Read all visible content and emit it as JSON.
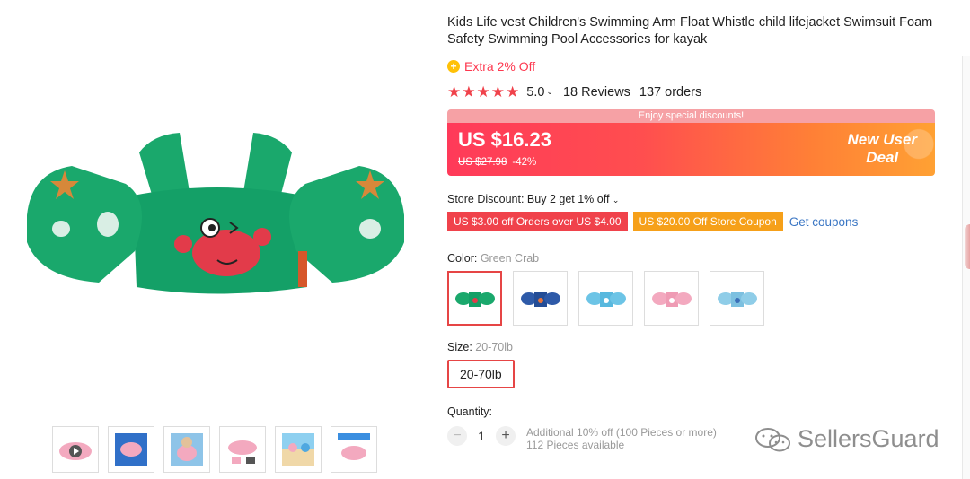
{
  "product": {
    "title": "Kids Life vest Children's Swimming Arm Float Whistle child lifejacket Swimsuit Foam Safety Swimming Pool Accessories for kayak",
    "extra_badge": "Extra 2% Off",
    "rating": {
      "stars": 5,
      "score": "5.0",
      "reviews": "18 Reviews",
      "orders": "137 orders"
    },
    "main_image": "green-crab-arm-float-vest",
    "thumbnails": [
      "pink-vest-video-thumb",
      "product-box-thumb",
      "child-wearing-vest-thumb",
      "pink-vest-detail-thumb",
      "kids-at-beach-thumb",
      "pink-vest-banner-thumb"
    ]
  },
  "deal": {
    "banner_text": "Enjoy special discounts!",
    "price": "US $16.23",
    "original_price": "US $27.98",
    "discount": "-42%",
    "badge_line1": "New User",
    "badge_line2": "Deal"
  },
  "store": {
    "discount_text": "Store Discount: Buy 2 get 1% off",
    "coupons": [
      "US $3.00 off Orders over US $4.00",
      "US $20.00 Off Store Coupon"
    ],
    "get_coupons": "Get coupons"
  },
  "color": {
    "label": "Color:",
    "selected": "Green Crab",
    "swatches": [
      "green",
      "navy",
      "light-blue",
      "pink",
      "sky-blue"
    ]
  },
  "size": {
    "label": "Size:",
    "selected": "20-70lb",
    "option": "20-70lb"
  },
  "quantity": {
    "label": "Quantity:",
    "value": "1",
    "minus": "−",
    "plus": "+",
    "note_line1": "Additional 10% off (100 Pieces or more)",
    "note_line2": "112 Pieces available"
  },
  "watermark": "SellersGuard",
  "colors": {
    "accent": "#f0424b",
    "link": "#3a76c4",
    "coupon_orange": "#f6a019",
    "selected_border": "#e64545"
  }
}
